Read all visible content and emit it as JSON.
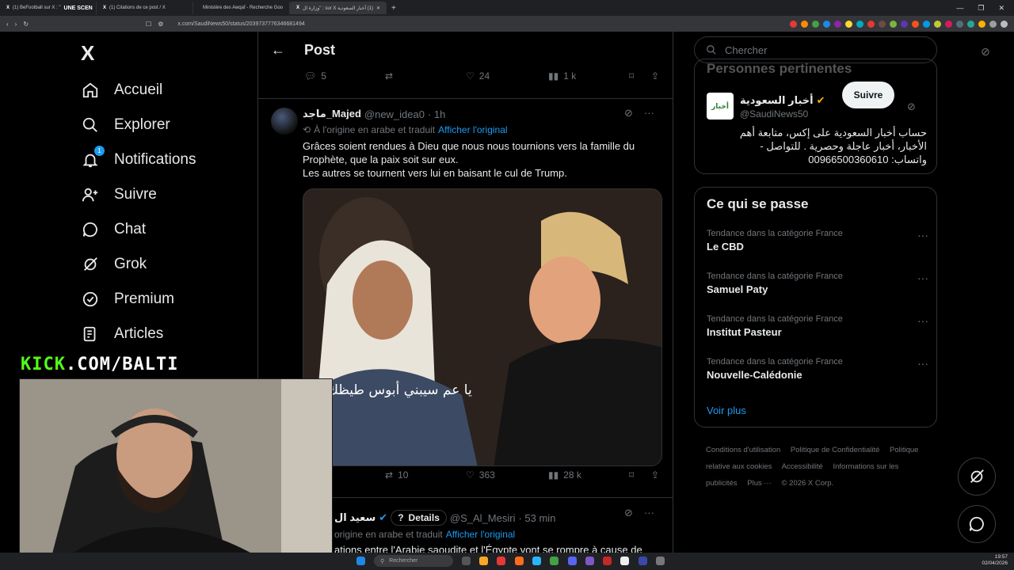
{
  "browser": {
    "tabs": [
      {
        "label": "(1) BeFootball sur X : \"",
        "extra": "UNE SCEN"
      },
      {
        "label": "(1) Citations de ce post / X",
        "extra": ""
      },
      {
        "label": "Ministère des Awqaf - Recherche Goo",
        "extra": ""
      },
      {
        "label": "(1) أخبار السعودية sur X : \"وزارة ال",
        "extra": ""
      }
    ],
    "url": "x.com/SaudiNews50/status/2039737776346681494",
    "window_controls": [
      "—",
      "❐",
      "✕"
    ]
  },
  "nav": {
    "logo": "X",
    "items": [
      {
        "label": "Accueil",
        "icon": "home-icon"
      },
      {
        "label": "Explorer",
        "icon": "search-icon"
      },
      {
        "label": "Notifications",
        "icon": "bell-icon",
        "badge": "1"
      },
      {
        "label": "Suivre",
        "icon": "follow-icon"
      },
      {
        "label": "Chat",
        "icon": "chat-icon"
      },
      {
        "label": "Grok",
        "icon": "grok-icon"
      },
      {
        "label": "Premium",
        "icon": "premium-icon"
      },
      {
        "label": "Articles",
        "icon": "articles-icon"
      }
    ]
  },
  "main": {
    "header_title": "Post",
    "top_actions": {
      "replies": "5",
      "reposts": "",
      "likes": "24",
      "views": "1 k"
    },
    "tweet1": {
      "name": "ماجد_Majed",
      "handle": "@new_idea0",
      "time": "· 1h",
      "translated_note": "À l'origine en arabe et traduit",
      "translated_link": "Afficher l'original",
      "text_lines": [
        "Grâces soient rendues à Dieu que nous nous tournions vers la famille du",
        "Prophète, que la paix soit sur eux.",
        "Les autres se tournent vers lui en baisant le cul de Trump."
      ],
      "image_caption": "يا عم سيبني أبوس طيظك",
      "actions": {
        "replies": "",
        "reposts": "10",
        "likes": "363",
        "views": "28 k"
      }
    },
    "tweet2": {
      "name": "سعيد ال",
      "details_label": "Details",
      "handle": "@S_Al_Mesiri",
      "time": "· 53 min",
      "translated_note": "origine en arabe et traduit",
      "translated_link": "Afficher l'original",
      "text": "ations entre l'Arabie saoudite et l'Égypte vont se rompre à cause de"
    }
  },
  "right": {
    "search_placeholder": "Chercher",
    "people_title": "Personnes pertinentes",
    "account": {
      "name": "أخبار السعودية",
      "handle": "@SaudiNews50",
      "follow_label": "Suivre",
      "bio": "حساب أخبار السعودية على إكس، متابعة أهم الأخبار، أخبار عاجلة وحصرية . للتواصل - واتساب: 00966500360610",
      "avatar_text": "أخبار"
    },
    "trends_title": "Ce qui se passe",
    "trends": [
      {
        "category": "Tendance dans la catégorie France",
        "name": "Le CBD"
      },
      {
        "category": "Tendance dans la catégorie France",
        "name": "Samuel Paty"
      },
      {
        "category": "Tendance dans la catégorie France",
        "name": "Institut Pasteur"
      },
      {
        "category": "Tendance dans la catégorie France",
        "name": "Nouvelle-Calédonie"
      }
    ],
    "show_more": "Voir plus",
    "footer": [
      "Conditions d'utilisation",
      "Politique de Confidentialité",
      "Politique relative aux cookies",
      "Accessibilité",
      "Informations sur les publicités",
      "Plus ···",
      "© 2026 X Corp."
    ]
  },
  "overlay": {
    "kick_green": "KICK",
    "kick_white": ".COM/BALTI"
  },
  "taskbar": {
    "search": "Rechercher",
    "time": "19:57",
    "date": "02/04/2026"
  },
  "colors": {
    "accent": "#1d9bf0",
    "kick": "#53fc18",
    "background": "#000000",
    "muted": "#71767b"
  }
}
